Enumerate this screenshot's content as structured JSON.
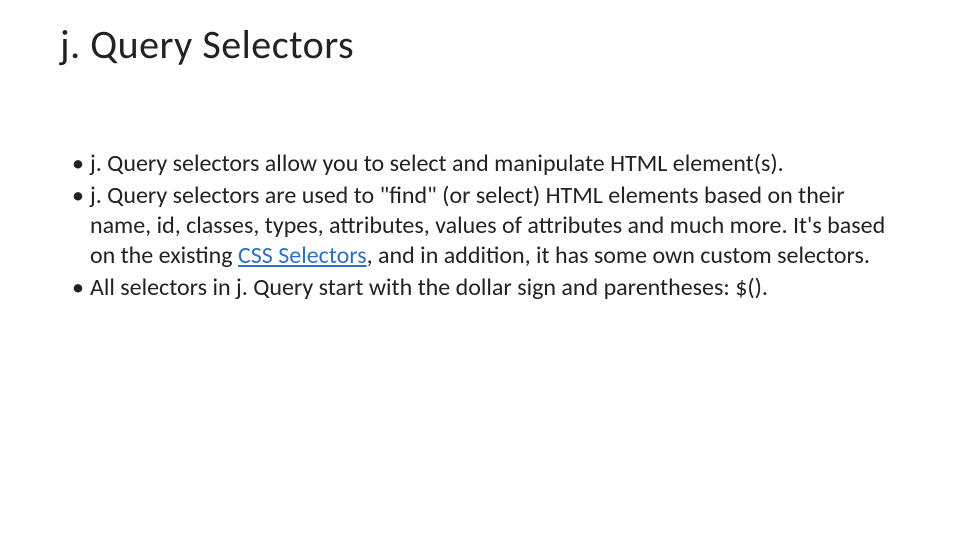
{
  "title": "j. Query Selectors",
  "bullets": {
    "b1": "j. Query selectors allow you to select and manipulate HTML element(s).",
    "b2_pre": "j. Query selectors are used to \"find\" (or select) HTML elements based on their name, id, classes, types, attributes, values of attributes and much more. It's based on the existing ",
    "b2_link": "CSS Selectors",
    "b2_post": ", and in addition, it has some own custom selectors.",
    "b3": "All selectors in j. Query start with the dollar sign and parentheses: $()."
  }
}
